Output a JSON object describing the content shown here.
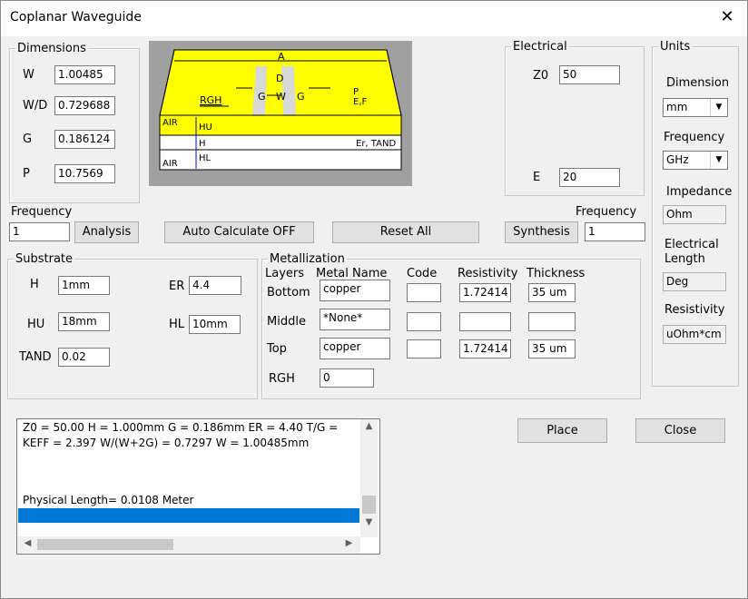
{
  "window": {
    "title": "Coplanar Waveguide",
    "close_glyph": "✕"
  },
  "diagram": {
    "A": "A",
    "D": "D",
    "G1": "G",
    "W": "W",
    "G2": "G",
    "RGH": "RGH",
    "P": "P",
    "EF": "E,F",
    "AIR_top": "AIR",
    "HU": "HU",
    "H": "H",
    "ErTAND": "Er, TAND",
    "AIR_bot": "AIR",
    "HL": "HL"
  },
  "dimensions": {
    "legend": "Dimensions",
    "W": {
      "label": "W",
      "value": "1.00485"
    },
    "WD": {
      "label": "W/D",
      "value": "0.729688"
    },
    "G": {
      "label": "G",
      "value": "0.186124"
    },
    "P": {
      "label": "P",
      "value": "10.7569"
    }
  },
  "electrical": {
    "legend": "Electrical",
    "Z0": {
      "label": "Z0",
      "value": "50"
    },
    "E": {
      "label": "E",
      "value": "20"
    }
  },
  "units": {
    "legend": "Units",
    "dimension": {
      "label": "Dimension",
      "value": "mm"
    },
    "frequency": {
      "label": "Frequency",
      "value": "GHz"
    },
    "impedance": {
      "label": "Impedance",
      "value": "Ohm"
    },
    "electrical_length": {
      "label1": "Electrical",
      "label2": "Length",
      "value": "Deg"
    },
    "resistivity": {
      "label": "Resistivity",
      "value": "uOhm*cm"
    }
  },
  "analysis": {
    "freq_label": "Frequency",
    "freq_value": "1",
    "button": "Analysis"
  },
  "synthesis": {
    "freq_label": "Frequency",
    "freq_value": "1",
    "button": "Synthesis"
  },
  "buttons": {
    "auto_calc": "Auto Calculate OFF",
    "reset_all": "Reset  All",
    "place": "Place",
    "close": "Close"
  },
  "substrate": {
    "legend": "Substrate",
    "H": {
      "label": "H",
      "value": "1mm"
    },
    "HU": {
      "label": "HU",
      "value": "18mm"
    },
    "TAND": {
      "label": "TAND",
      "value": "0.02"
    },
    "ER": {
      "label": "ER",
      "value": "4.4"
    },
    "HL": {
      "label": "HL",
      "value": "10mm"
    }
  },
  "metallization": {
    "legend": "Metallization",
    "headers": {
      "layers": "Layers",
      "metal_name": "Metal Name",
      "code": "Code",
      "resistivity": "Resistivity",
      "thickness": "Thickness"
    },
    "rows": [
      {
        "layer": "Bottom",
        "metal": "copper",
        "code": "",
        "resistivity": "1.72414",
        "thickness": "35 um"
      },
      {
        "layer": "Middle",
        "metal": "*None*",
        "code": "",
        "resistivity": "",
        "thickness": ""
      },
      {
        "layer": "Top",
        "metal": "copper",
        "code": "",
        "resistivity": "1.72414",
        "thickness": "35 um"
      }
    ],
    "rgh": {
      "label": "RGH",
      "value": "0"
    }
  },
  "results": {
    "line1": "Z0 =  50.00   H =   1.000mm    G =   0.186mm    ER =  4.40   T/G =",
    "line2": "KEFF =  2.397  W/(W+2G) = 0.7297   W =   1.00485mm",
    "line3": "Physical Length=      0.0108 Meter"
  },
  "colors": {
    "accent": "#0078d7",
    "diagram_yellow": "#ffff00",
    "diagram_bg": "#a0a0a0"
  }
}
